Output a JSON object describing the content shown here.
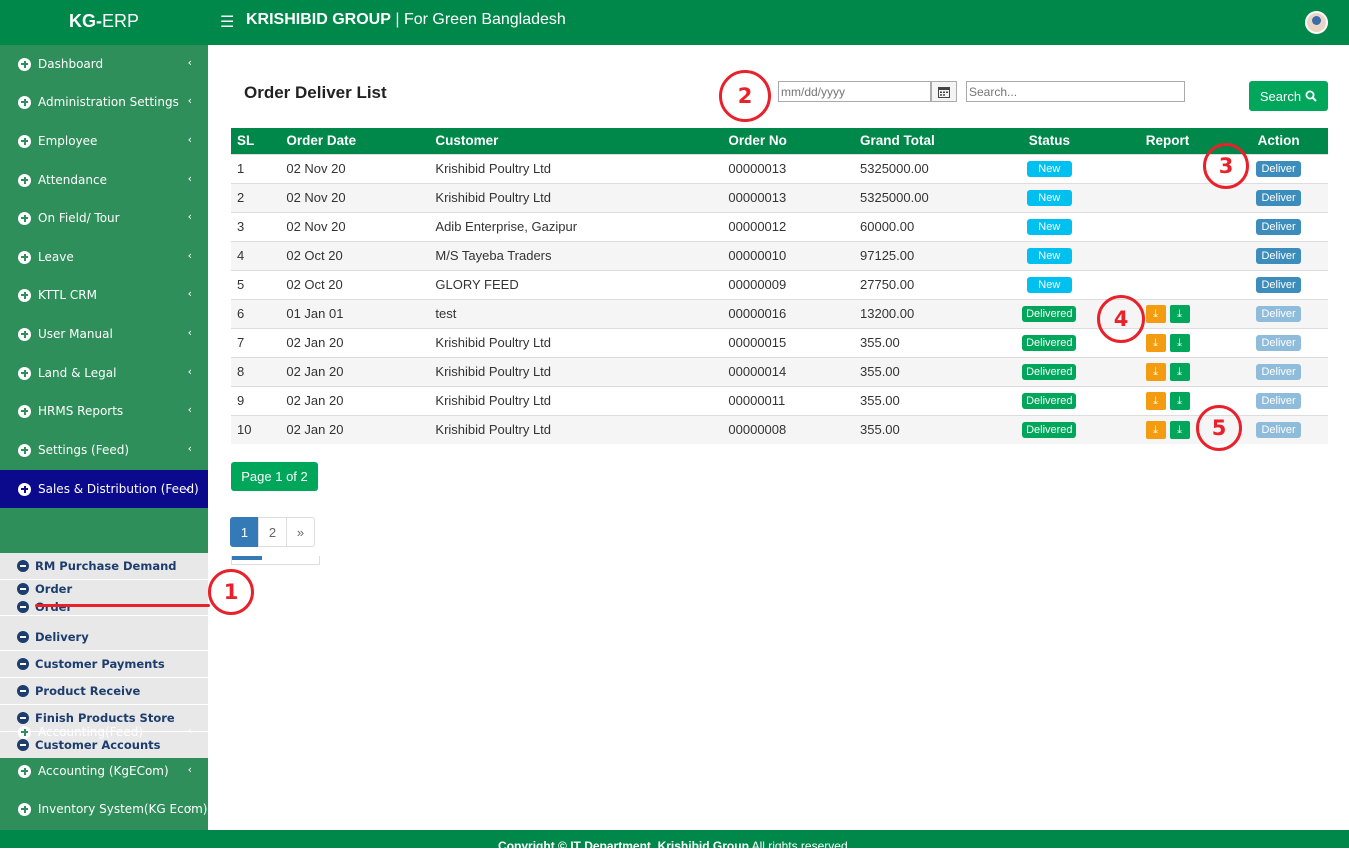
{
  "topbar": {
    "brand_bold": "KG-",
    "brand_rest": "ERP",
    "group_name": "KRISHIBID GROUP",
    "tagline": " | For Green Bangladesh"
  },
  "sidebar": {
    "items": [
      {
        "label": "Dashboard"
      },
      {
        "label": "Administration Settings"
      },
      {
        "label": "Employee"
      },
      {
        "label": "Attendance"
      },
      {
        "label": "On Field/ Tour"
      },
      {
        "label": "Leave"
      },
      {
        "label": "KTTL CRM"
      },
      {
        "label": "User Manual"
      },
      {
        "label": "Land & Legal"
      },
      {
        "label": "HRMS Reports"
      },
      {
        "label": "Settings (Feed)"
      },
      {
        "label": "Sales & Distribution (Feed)"
      },
      {
        "label": "Accounting(Feed)"
      },
      {
        "label": "Accounting (KgECom)"
      },
      {
        "label": "Inventory System(KG Ecom)"
      }
    ],
    "sub_items": [
      {
        "label": "RM Purchase Demand"
      },
      {
        "label": "Order"
      },
      {
        "label": "Order"
      },
      {
        "label": "Delivery"
      },
      {
        "label": "Customer Payments"
      },
      {
        "label": "Product Receive"
      },
      {
        "label": "Finish Products Store"
      },
      {
        "label": "Customer Accounts"
      }
    ]
  },
  "main": {
    "title": "Order Deliver List",
    "date_placeholder": "mm/dd/yyyy",
    "search_placeholder": "Search...",
    "search_button": "Search",
    "columns": [
      "SL",
      "Order Date",
      "Customer",
      "Order No",
      "Grand Total",
      "Status",
      "Report",
      "Action"
    ],
    "rows": [
      {
        "sl": "1",
        "date": "02 Nov 20",
        "customer": "Krishibid Poultry Ltd",
        "order_no": "00000013",
        "total": "5325000.00",
        "status": "New",
        "action": "Deliver"
      },
      {
        "sl": "2",
        "date": "02 Nov 20",
        "customer": "Krishibid Poultry Ltd",
        "order_no": "00000013",
        "total": "5325000.00",
        "status": "New",
        "action": "Deliver"
      },
      {
        "sl": "3",
        "date": "02 Nov 20",
        "customer": "Adib Enterprise, Gazipur",
        "order_no": "00000012",
        "total": "60000.00",
        "status": "New",
        "action": "Deliver"
      },
      {
        "sl": "4",
        "date": "02 Oct 20",
        "customer": "M/S Tayeba Traders",
        "order_no": "00000010",
        "total": "97125.00",
        "status": "New",
        "action": "Deliver"
      },
      {
        "sl": "5",
        "date": "02 Oct 20",
        "customer": "GLORY FEED",
        "order_no": "00000009",
        "total": "27750.00",
        "status": "New",
        "action": "Deliver"
      },
      {
        "sl": "6",
        "date": "01 Jan 01",
        "customer": "test",
        "order_no": "00000016",
        "total": "13200.00",
        "status": "Delivered",
        "action": "Deliver"
      },
      {
        "sl": "7",
        "date": "02 Jan 20",
        "customer": "Krishibid Poultry Ltd",
        "order_no": "00000015",
        "total": "355.00",
        "status": "Delivered",
        "action": "Deliver"
      },
      {
        "sl": "8",
        "date": "02 Jan 20",
        "customer": "Krishibid Poultry Ltd",
        "order_no": "00000014",
        "total": "355.00",
        "status": "Delivered",
        "action": "Deliver"
      },
      {
        "sl": "9",
        "date": "02 Jan 20",
        "customer": "Krishibid Poultry Ltd",
        "order_no": "00000011",
        "total": "355.00",
        "status": "Delivered",
        "action": "Deliver"
      },
      {
        "sl": "10",
        "date": "02 Jan 20",
        "customer": "Krishibid Poultry Ltd",
        "order_no": "00000008",
        "total": "355.00",
        "status": "Delivered",
        "action": "Deliver"
      }
    ],
    "page_info": "Page 1 of 2",
    "pagination": [
      "1",
      "2",
      "»"
    ]
  },
  "footer": {
    "text_bold": "Copyright © IT Department, Krishibid Group",
    "text_rest": " All rights reserved."
  },
  "callouts": [
    "1",
    "2",
    "3",
    "4",
    "5"
  ],
  "colors": {
    "header_green": "#00884a",
    "sidebar_green": "#2e8f5a",
    "active_navy": "#0b0a8c",
    "new_badge": "#00c0ef",
    "delivered_badge": "#00a65a",
    "deliver_button": "#3c8dbc",
    "report_orange": "#f39c12",
    "annotation_red": "#e8212a"
  },
  "icons": [
    "menu-icon",
    "calendar-icon",
    "search-icon",
    "download-icon",
    "plus-circle-icon",
    "minus-circle-icon",
    "chevron-left-icon",
    "chevron-down-icon"
  ]
}
